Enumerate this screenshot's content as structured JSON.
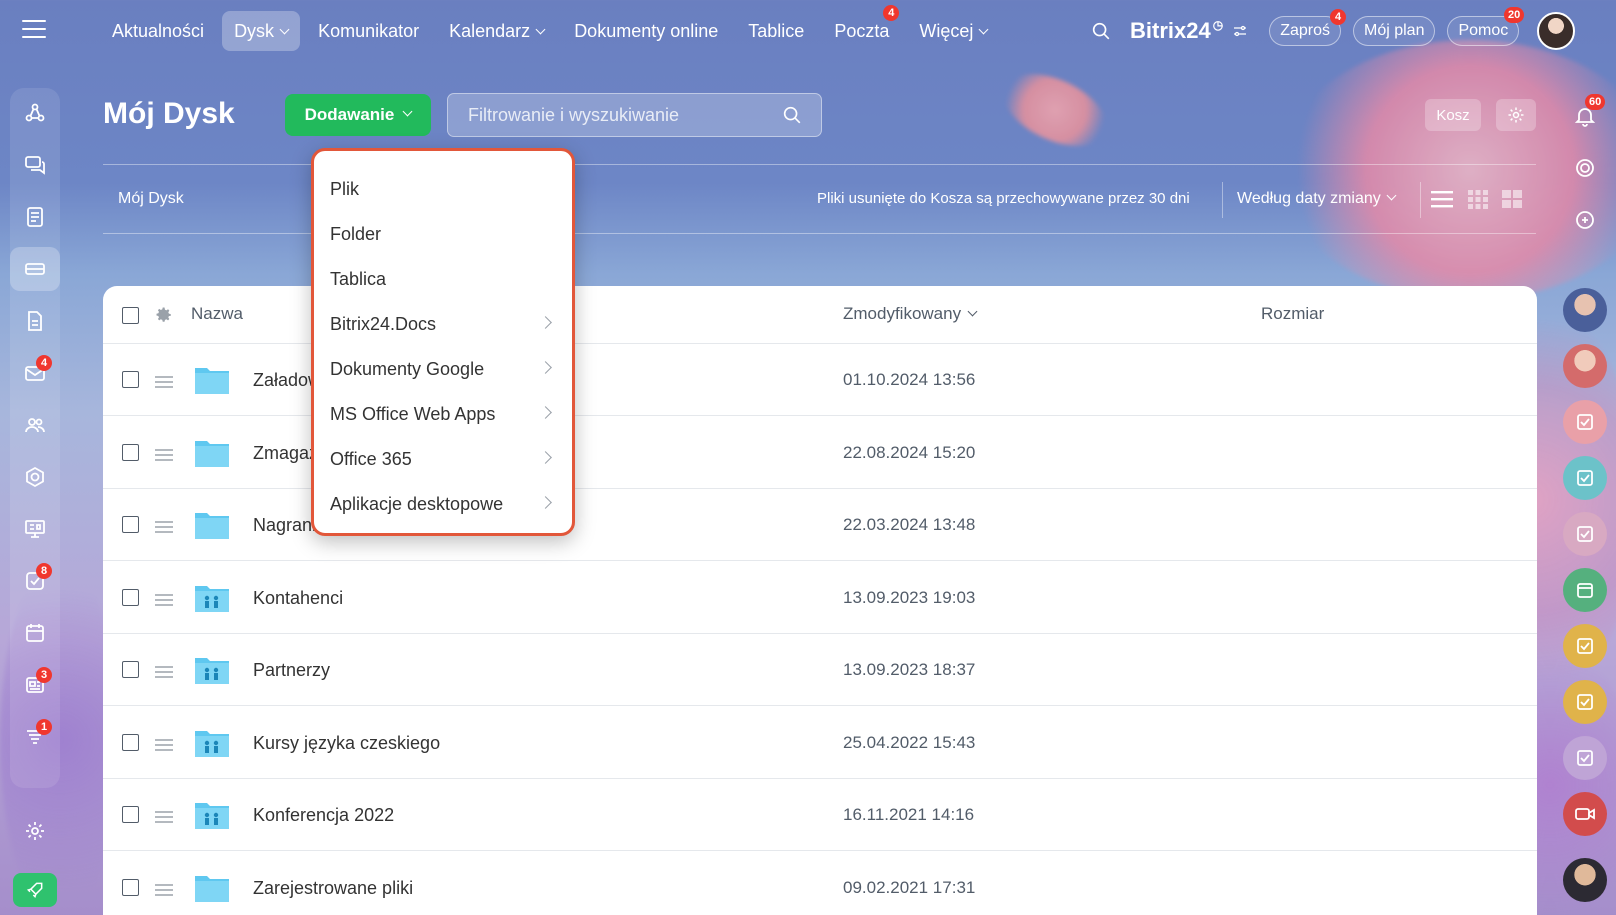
{
  "topnav": {
    "items": [
      {
        "label": "Aktualności",
        "dropdown": false,
        "active": false
      },
      {
        "label": "Dysk",
        "dropdown": true,
        "active": true
      },
      {
        "label": "Komunikator",
        "dropdown": false,
        "active": false
      },
      {
        "label": "Kalendarz",
        "dropdown": true,
        "active": false
      },
      {
        "label": "Dokumenty online",
        "dropdown": false,
        "active": false
      },
      {
        "label": "Tablice",
        "dropdown": false,
        "active": false
      },
      {
        "label": "Poczta",
        "dropdown": false,
        "active": false,
        "badge": "4"
      },
      {
        "label": "Więcej",
        "dropdown": true,
        "active": false
      }
    ],
    "brand": "Bitrix24",
    "invite_label": "Zaproś",
    "invite_badge": "4",
    "plan_label": "Mój plan",
    "help_label": "Pomoc",
    "help_badge": "20"
  },
  "left_rail": {
    "mail_badge": "4",
    "tasks_badge": "8",
    "news_badge": "3",
    "funnel_badge": "1"
  },
  "header": {
    "title": "Mój Dysk",
    "add_button": "Dodawanie",
    "search_placeholder": "Filtrowanie i wyszukiwanie",
    "trash_button": "Kosz",
    "notifications_badge": "60"
  },
  "toolbar": {
    "breadcrumb": "Mój Dysk",
    "trash_note": "Pliki usunięte do Kosza są przechowywane przez 30 dni",
    "sort_label": "Według daty zmiany"
  },
  "table": {
    "columns": {
      "name": "Nazwa",
      "modified": "Zmodyfikowany",
      "size": "Rozmiar"
    },
    "rows": [
      {
        "name": "Załadowane pliki",
        "date": "01.10.2024 13:56",
        "shared": false
      },
      {
        "name": "Zmagazynowane pliki",
        "date": "22.08.2024 15:20",
        "shared": false
      },
      {
        "name": "Nagrania rozmów",
        "date": "22.03.2024 13:48",
        "shared": false
      },
      {
        "name": "Kontahenci",
        "date": "13.09.2023 19:03",
        "shared": true
      },
      {
        "name": "Partnerzy",
        "date": "13.09.2023 18:37",
        "shared": true
      },
      {
        "name": "Kursy języka czeskiego",
        "date": "25.04.2022 15:43",
        "shared": true
      },
      {
        "name": "Konferencja 2022",
        "date": "16.11.2021 14:16",
        "shared": true
      },
      {
        "name": "Zarejestrowane pliki",
        "date": "09.02.2021 17:31",
        "shared": false
      }
    ]
  },
  "dropdown": {
    "items": [
      {
        "label": "Plik",
        "submenu": false
      },
      {
        "label": "Folder",
        "submenu": false
      },
      {
        "label": "Tablica",
        "submenu": false
      },
      {
        "label": "Bitrix24.Docs",
        "submenu": true
      },
      {
        "label": "Dokumenty Google",
        "submenu": true
      },
      {
        "label": "MS Office Web Apps",
        "submenu": true
      },
      {
        "label": "Office 365",
        "submenu": true
      },
      {
        "label": "Aplikacje desktopowe",
        "submenu": true
      }
    ]
  },
  "colors": {
    "accent_green": "#22ba5c",
    "menu_border": "#e2573a",
    "folder": "#5fc8f0",
    "badge": "#f0372e"
  }
}
